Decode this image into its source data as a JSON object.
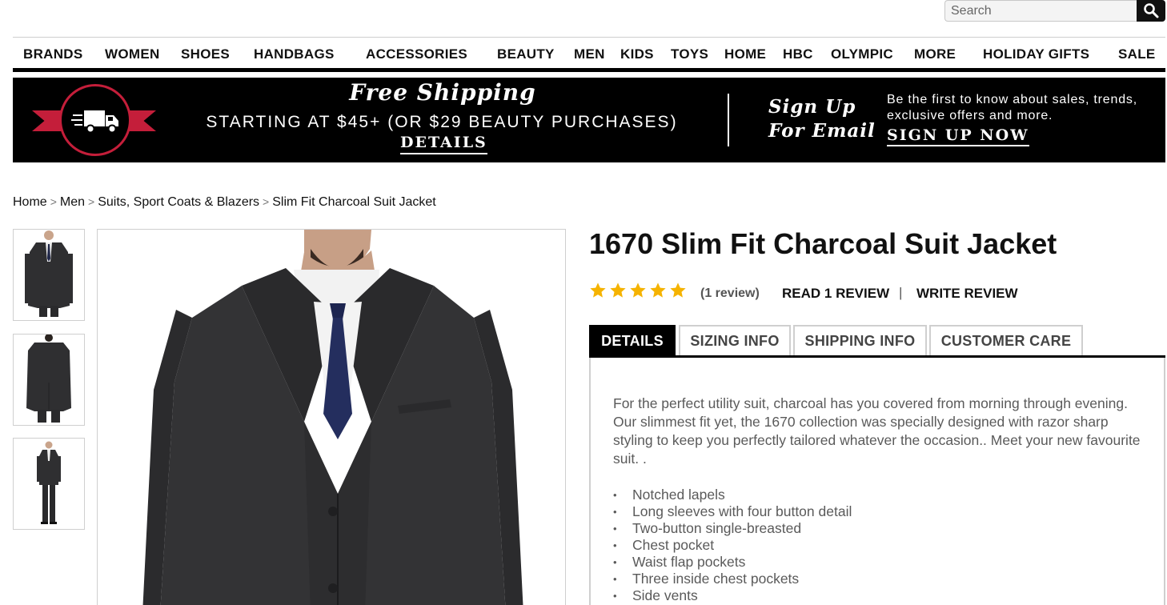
{
  "search": {
    "placeholder": "Search"
  },
  "nav": {
    "items": [
      "BRANDS",
      "WOMEN",
      "SHOES",
      "HANDBAGS",
      "ACCESSORIES",
      "BEAUTY",
      "MEN",
      "KIDS",
      "TOYS",
      "HOME",
      "HBC",
      "OLYMPIC",
      "MORE",
      "HOLIDAY GIFTS",
      "SALE"
    ]
  },
  "banner": {
    "shipping_title": "Free Shipping",
    "shipping_sub": "STARTING AT $45+ (OR $29 BEAUTY PURCHASES)",
    "shipping_cta": "DETAILS",
    "email_title_line1": "Sign Up",
    "email_title_line2": "For Email",
    "email_desc": "Be the first to know about sales, trends, exclusive offers and more.",
    "email_cta": "SIGN UP NOW",
    "accent_color": "#c41e3a"
  },
  "breadcrumb": {
    "items": [
      "Home",
      "Men",
      "Suits, Sport Coats & Blazers",
      "Slim Fit Charcoal Suit Jacket"
    ],
    "separator": ">"
  },
  "product": {
    "title": "1670 Slim Fit Charcoal Suit Jacket",
    "rating": 5,
    "rating_max": 5,
    "review_count_text": "(1 review)",
    "read_review": "READ 1 REVIEW",
    "review_separator": "|",
    "write_review": "WRITE REVIEW",
    "star_color": "#f5b301"
  },
  "tabs": {
    "items": [
      "DETAILS",
      "SIZING INFO",
      "SHIPPING INFO",
      "CUSTOMER CARE"
    ],
    "active": "DETAILS"
  },
  "details": {
    "description": "For the perfect utility suit, charcoal has you covered from morning through evening. Our slimmest fit yet, the 1670 collection was specially designed with razor sharp styling to keep you perfectly tailored whatever the occasion.. Meet your new favourite suit. .",
    "features": [
      "Notched lapels",
      "Long sleeves with four button detail",
      "Two-button single-breasted",
      "Chest pocket",
      "Waist flap pockets",
      "Three inside chest pockets",
      "Side vents"
    ]
  },
  "icons": {
    "search": "search-icon",
    "truck": "truck-icon",
    "star": "star-icon"
  }
}
